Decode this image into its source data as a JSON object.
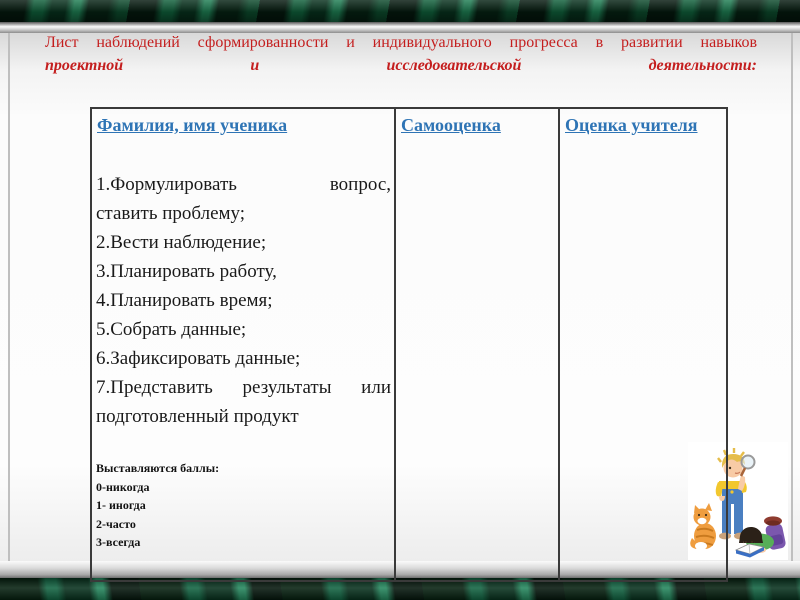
{
  "slide": {
    "title_line1": "Лист наблюдений сформированности и индивидуального прогресса в развитии навыков",
    "title_line2": "проектной и исследовательской деятельности:",
    "colors": {
      "title_red": "#c41e1e",
      "header_blue": "#2e74b5",
      "frame_green": "#07311d",
      "table_border": "#3a3a3a"
    }
  },
  "table": {
    "headers": [
      "Фамилия, имя ученика",
      "Самооценка",
      "Оценка учителя"
    ],
    "skills_lines": [
      "1.Формулировать вопрос,",
      "ставить проблему;",
      "2.Вести наблюдение;",
      "3.Планировать работу,",
      "4.Планировать время;",
      "5.Собрать данные;",
      "6.Зафиксировать данные;",
      "7.Представить результаты или",
      "подготовленный продукт"
    ],
    "scoring": {
      "title": "Выставляются баллы:",
      "items": [
        "0-никогда",
        "1- иногда",
        "2-часто",
        "3-всегда"
      ]
    }
  },
  "clipart": {
    "name": "children-studying-clipart"
  }
}
